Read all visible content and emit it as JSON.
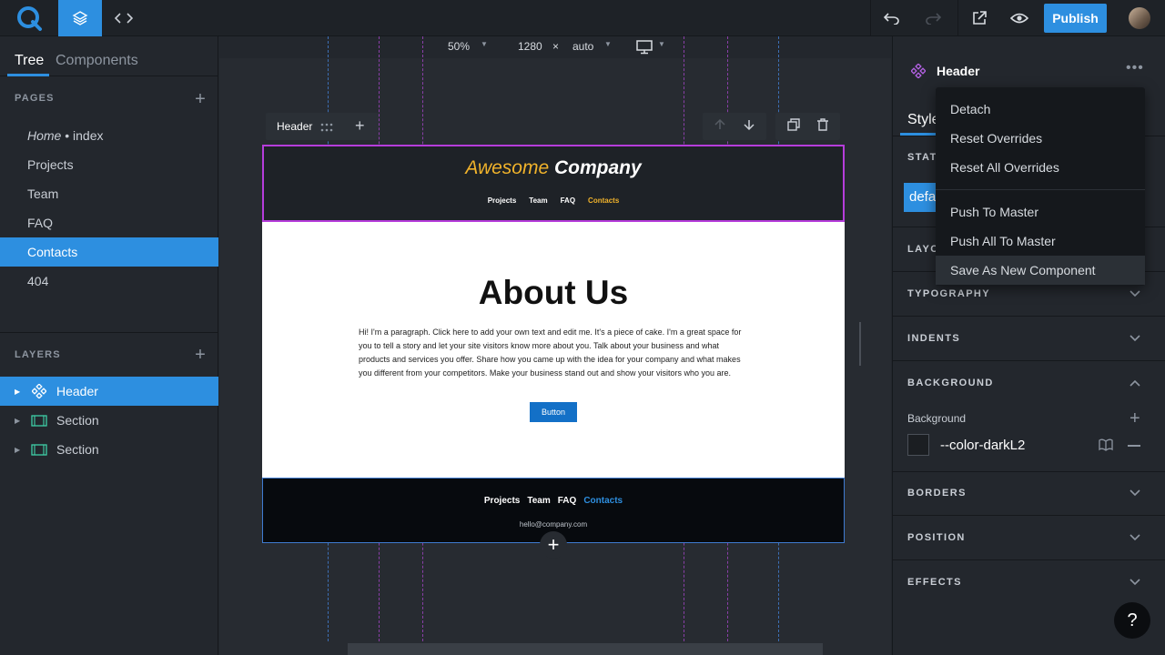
{
  "topbar": {
    "publish_label": "Publish",
    "logo_icon": "q-logo-icon",
    "accent": "#2d8fe0"
  },
  "left": {
    "tabs": [
      "Tree",
      "Components"
    ],
    "pages_label": "PAGES",
    "pages": [
      {
        "label": "Home",
        "suffix": " • index"
      },
      {
        "label": "Projects"
      },
      {
        "label": "Team"
      },
      {
        "label": "FAQ"
      },
      {
        "label": "Contacts"
      },
      {
        "label": "404"
      }
    ],
    "active_page": "Contacts",
    "layers_label": "LAYERS",
    "layers": [
      {
        "label": "Header",
        "icon": "component-icon"
      },
      {
        "label": "Section",
        "icon": "section-icon"
      },
      {
        "label": "Section",
        "icon": "section-icon"
      }
    ]
  },
  "canvas": {
    "zoom": "50%",
    "width": "1280",
    "times": "×",
    "height": "auto",
    "device_icon": "desktop-icon",
    "selected_label": "Header"
  },
  "site": {
    "brand_a": "Awesome",
    "brand_b": "Company",
    "header_nav": [
      "Projects",
      "Team",
      "FAQ",
      "Contacts"
    ],
    "about_title": "About Us",
    "about_text": "Hi! I'm a paragraph. Click here to add your own text and edit me. It's a piece of cake. I'm a great space for you to tell a story and let your site visitors know more about you. Talk about your business and what products and services you offer. Share how you came up with the idea for your company and what makes you different from your competitors. Make your business stand out and show your visitors who you are.",
    "button_label": "Button",
    "footer_nav": [
      "Projects",
      "Team",
      "FAQ",
      "Contacts"
    ],
    "footer_email": "hello@company.com"
  },
  "right": {
    "title": "Header",
    "style_tab": "Style",
    "states_label": "STATE",
    "default_chip": "defa",
    "sections": [
      "LAYOU",
      "TYPOGRAPHY",
      "INDENTS",
      "BACKGROUND",
      "BORDERS",
      "POSITION",
      "EFFECTS"
    ],
    "background_label": "Background",
    "background_value": "--color-darkL2",
    "menu": [
      "Detach",
      "Reset Overrides",
      "Reset All Overrides",
      "Push To Master",
      "Push All To Master",
      "Save As New Component"
    ]
  },
  "help_label": "?"
}
